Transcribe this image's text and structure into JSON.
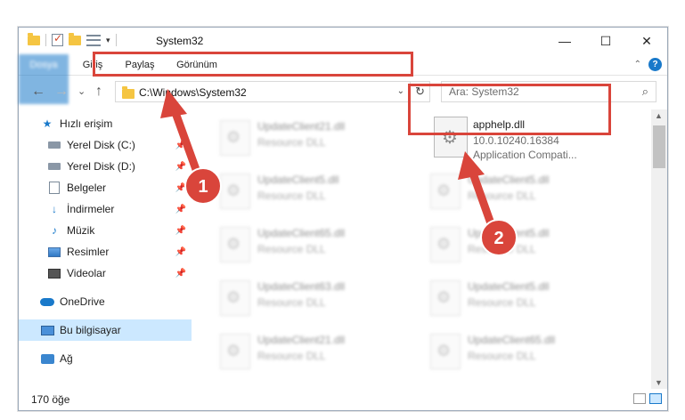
{
  "window": {
    "title": "System32",
    "minimize": "—",
    "maximize": "☐",
    "close": "✕"
  },
  "ribbon": {
    "tabs": [
      "Dosya",
      "Giriş",
      "Paylaş",
      "Görünüm"
    ]
  },
  "navigation": {
    "back": "←",
    "forward": "→",
    "recent": "⌄",
    "up": "↑",
    "address_path": "C:\\Windows\\System32",
    "search_placeholder": "Ara: System32"
  },
  "sidebar": {
    "items": [
      {
        "label": "Hızlı erişim",
        "icon": "star-icon",
        "pinned": false
      },
      {
        "label": "Yerel Disk (C:)",
        "icon": "disk-icon",
        "pinned": true
      },
      {
        "label": "Yerel Disk (D:)",
        "icon": "disk-icon",
        "pinned": true
      },
      {
        "label": "Belgeler",
        "icon": "document-icon",
        "pinned": true
      },
      {
        "label": "İndirmeler",
        "icon": "download-icon",
        "pinned": true
      },
      {
        "label": "Müzik",
        "icon": "music-icon",
        "pinned": true
      },
      {
        "label": "Resimler",
        "icon": "pictures-icon",
        "pinned": true
      },
      {
        "label": "Videolar",
        "icon": "videos-icon",
        "pinned": true
      },
      {
        "label": "OneDrive",
        "icon": "cloud-icon",
        "pinned": false
      },
      {
        "label": "Bu bilgisayar",
        "icon": "computer-icon",
        "pinned": false,
        "selected": true
      },
      {
        "label": "Ağ",
        "icon": "network-icon",
        "pinned": false
      }
    ]
  },
  "files": {
    "left_column": [
      {
        "name": "UpdateClient21.dll",
        "type": "Resource DLL"
      },
      {
        "name": "UpdateClient5.dll",
        "type": "Resource DLL"
      },
      {
        "name": "UpdateClient65.dll",
        "type": "Resource DLL"
      },
      {
        "name": "UpdateClient63.dll",
        "type": "Resource DLL"
      },
      {
        "name": "UpdateClient21.dll",
        "type": "Resource DLL"
      }
    ],
    "right_column": [
      {
        "name": "UpdateClient5.dll",
        "type": "Resource DLL"
      },
      {
        "name": "UpdateClient5.dll",
        "type": "Resource DLL"
      },
      {
        "name": "UpdateClient5.dll",
        "type": "Resource DLL"
      },
      {
        "name": "UpdateClient65.dll",
        "type": "Resource DLL"
      }
    ],
    "highlighted": {
      "name": "apphelp.dll",
      "version": "10.0.10240.16384",
      "description": "Application Compati..."
    }
  },
  "status": {
    "item_count": "170 öğe"
  },
  "annotations": {
    "step1": "1",
    "step2": "2",
    "color": "#d9453b"
  }
}
